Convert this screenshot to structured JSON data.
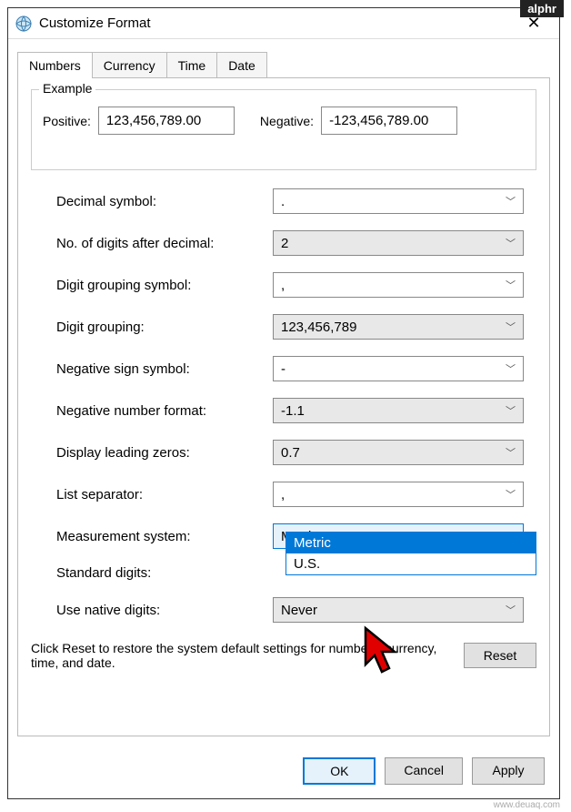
{
  "badge": "alphr",
  "window": {
    "title": "Customize Format"
  },
  "tabs": [
    "Numbers",
    "Currency",
    "Time",
    "Date"
  ],
  "example": {
    "legend": "Example",
    "positive_label": "Positive:",
    "positive_value": "123,456,789.00",
    "negative_label": "Negative:",
    "negative_value": "-123,456,789.00"
  },
  "fields": {
    "decimal_symbol": {
      "label": "Decimal symbol:",
      "value": "."
    },
    "digits_after": {
      "label": "No. of digits after decimal:",
      "value": "2"
    },
    "grouping_symbol": {
      "label": "Digit grouping symbol:",
      "value": ","
    },
    "digit_grouping": {
      "label": "Digit grouping:",
      "value": "123,456,789"
    },
    "negative_sign": {
      "label": "Negative sign symbol:",
      "value": "-"
    },
    "negative_format": {
      "label": "Negative number format:",
      "value": "-1.1"
    },
    "leading_zeros": {
      "label": "Display leading zeros:",
      "value": "0.7"
    },
    "list_separator": {
      "label": "List separator:",
      "value": ","
    },
    "measurement": {
      "label": "Measurement system:",
      "value": "Metric",
      "options": [
        "Metric",
        "U.S."
      ]
    },
    "standard_digits": {
      "label": "Standard digits:",
      "value": ""
    },
    "use_native": {
      "label": "Use native digits:",
      "value": "Never"
    }
  },
  "reset": {
    "text": "Click Reset to restore the system default settings for numbers, currency, time, and date.",
    "button": "Reset"
  },
  "buttons": {
    "ok": "OK",
    "cancel": "Cancel",
    "apply": "Apply"
  },
  "watermark": "www.deuaq.com"
}
